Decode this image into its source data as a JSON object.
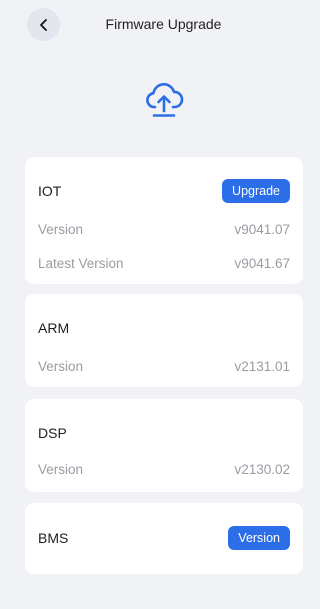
{
  "header": {
    "title": "Firmware Upgrade",
    "back_icon": "chevron-left-icon"
  },
  "hero": {
    "icon": "cloud-upload-icon",
    "color": "#2c6ee8"
  },
  "colors": {
    "background": "#f1f2f6",
    "card": "#ffffff",
    "accent": "#2c6ee8",
    "muted_text": "#9a9ca3"
  },
  "modules": {
    "iot": {
      "name": "IOT",
      "button_label": "Upgrade",
      "version_label": "Version",
      "version_value": "v9041.07",
      "latest_label": "Latest Version",
      "latest_value": "v9041.67"
    },
    "arm": {
      "name": "ARM",
      "version_label": "Version",
      "version_value": "v2131.01"
    },
    "dsp": {
      "name": "DSP",
      "version_label": "Version",
      "version_value": "v2130.02"
    },
    "bms": {
      "name": "BMS",
      "button_label": "Version"
    }
  }
}
